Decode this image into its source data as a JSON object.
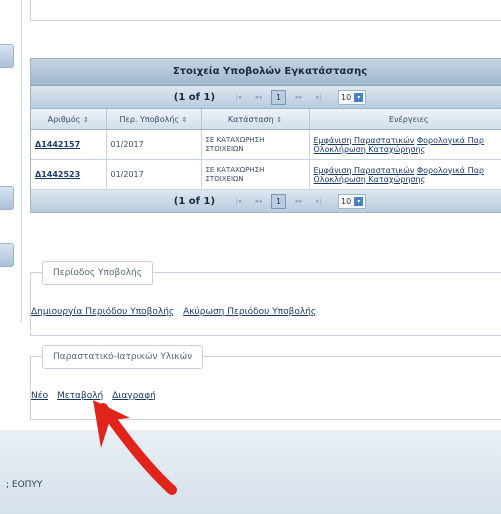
{
  "table": {
    "title": "Στοιχεία Υποβολών Εγκατάστασης",
    "page_report": "(1 of 1)",
    "current_page": "1",
    "rows_per_page": "10",
    "columns": [
      "Αριθμός",
      "Περ. Υποβολής",
      "Κατάσταση",
      "Ενέργειες"
    ],
    "rows": [
      {
        "id": "Δ1442157",
        "period": "01/2017",
        "status": "ΣΕ ΚΑΤΑΧΩΡΗΣΗ ΣΤΟΙΧΕΙΩΝ",
        "action1": "Εμφάνιση Παραστατικών",
        "action2": "Φορολογικά Παρ",
        "action3": "Ολοκλήρωση Καταχώρησης"
      },
      {
        "id": "Δ1442523",
        "period": "01/2017",
        "status": "ΣΕ ΚΑΤΑΧΩΡΗΣΗ ΣΤΟΙΧΕΙΩΝ",
        "action1": "Εμφάνιση Παραστατικών",
        "action2": "Φορολογικά Παρ",
        "action3": "Ολοκλήρωση Καταχώρησης"
      }
    ]
  },
  "submission_period": {
    "legend": "Περίοδος Υποβολής",
    "create_link": "Δημιουργία Περιόδου Υποβολής",
    "cancel_link": "Ακύρωση Περιόδου Υποβολής"
  },
  "documents": {
    "legend": "Παραστατικό-Ιατρικών Υλικών",
    "new_link": "Νέο",
    "edit_link": "Μεταβολή",
    "delete_link": "Διαγραφή"
  },
  "footer": {
    "text": "; ΕΟΠΥΥ"
  },
  "annotation": {
    "color": "#e0241b"
  }
}
